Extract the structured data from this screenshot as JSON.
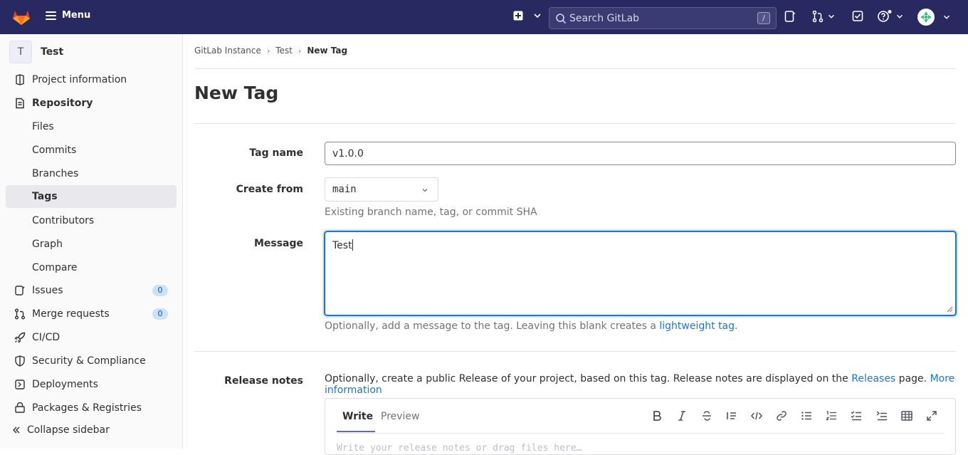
{
  "topbar": {
    "menu_label": "Menu",
    "search_placeholder": "Search GitLab",
    "search_shortcut": "/"
  },
  "sidebar": {
    "project_initial": "T",
    "project_name": "Test",
    "items": [
      {
        "label": "Project information",
        "icon": "info-icon"
      },
      {
        "label": "Repository",
        "icon": "repository-icon"
      },
      {
        "label": "Files"
      },
      {
        "label": "Commits"
      },
      {
        "label": "Branches"
      },
      {
        "label": "Tags"
      },
      {
        "label": "Contributors"
      },
      {
        "label": "Graph"
      },
      {
        "label": "Compare"
      },
      {
        "label": "Issues",
        "icon": "issues-icon",
        "badge": "0"
      },
      {
        "label": "Merge requests",
        "icon": "merge-request-icon",
        "badge": "0"
      },
      {
        "label": "CI/CD",
        "icon": "rocket-icon"
      },
      {
        "label": "Security & Compliance",
        "icon": "shield-icon"
      },
      {
        "label": "Deployments",
        "icon": "deployments-icon"
      },
      {
        "label": "Packages & Registries",
        "icon": "package-icon"
      }
    ],
    "collapse_label": "Collapse sidebar"
  },
  "breadcrumb": {
    "items": [
      "GitLab Instance",
      "Test",
      "New Tag"
    ]
  },
  "page": {
    "title": "New Tag"
  },
  "form": {
    "tag_name_label": "Tag name",
    "tag_name_value": "v1.0.0",
    "create_from_label": "Create from",
    "create_from_value": "main",
    "create_from_help": "Existing branch name, tag, or commit SHA",
    "message_label": "Message",
    "message_value": "Test",
    "message_help_prefix": "Optionally, add a message to the tag. Leaving this blank creates a ",
    "message_help_link": "lightweight tag",
    "message_help_suffix": ".",
    "release_notes_label": "Release notes",
    "release_help_prefix": "Optionally, create a public Release of your project, based on this tag. Release notes are displayed on the ",
    "release_help_link1": "Releases",
    "release_help_middle": " page. ",
    "release_help_link2": "More information"
  },
  "editor": {
    "tab_write": "Write",
    "tab_preview": "Preview",
    "placeholder": "Write your release notes or drag files here…",
    "toolbar": [
      "bold-icon",
      "italic-icon",
      "strikethrough-icon",
      "quote-icon",
      "code-icon",
      "link-icon",
      "bulleted-list-icon",
      "numbered-list-icon",
      "task-list-icon",
      "collapsible-icon",
      "table-icon",
      "fullscreen-icon"
    ]
  },
  "colors": {
    "navbar": "#292961",
    "link": "#1f75cb",
    "focus": "#1f75cb"
  }
}
